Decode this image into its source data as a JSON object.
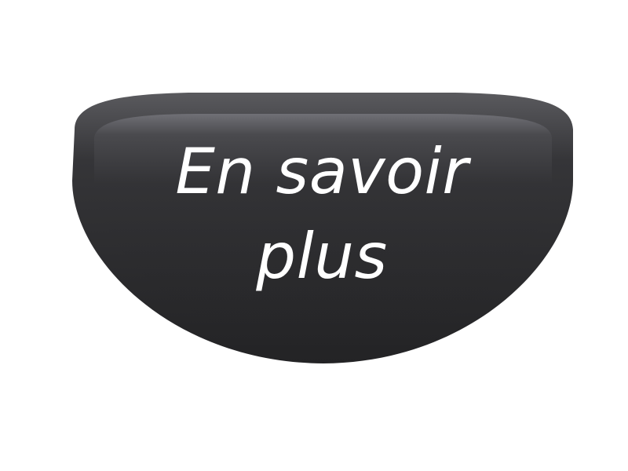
{
  "button": {
    "line1": "En savoir",
    "line2": "plus",
    "colors": {
      "body_dark": "#1c1c1e",
      "body_mid": "#2e2e30",
      "rim_light": "#5c5c60",
      "highlight": "#6a6a70",
      "text": "#ffffff",
      "background": "#ffffff"
    }
  }
}
